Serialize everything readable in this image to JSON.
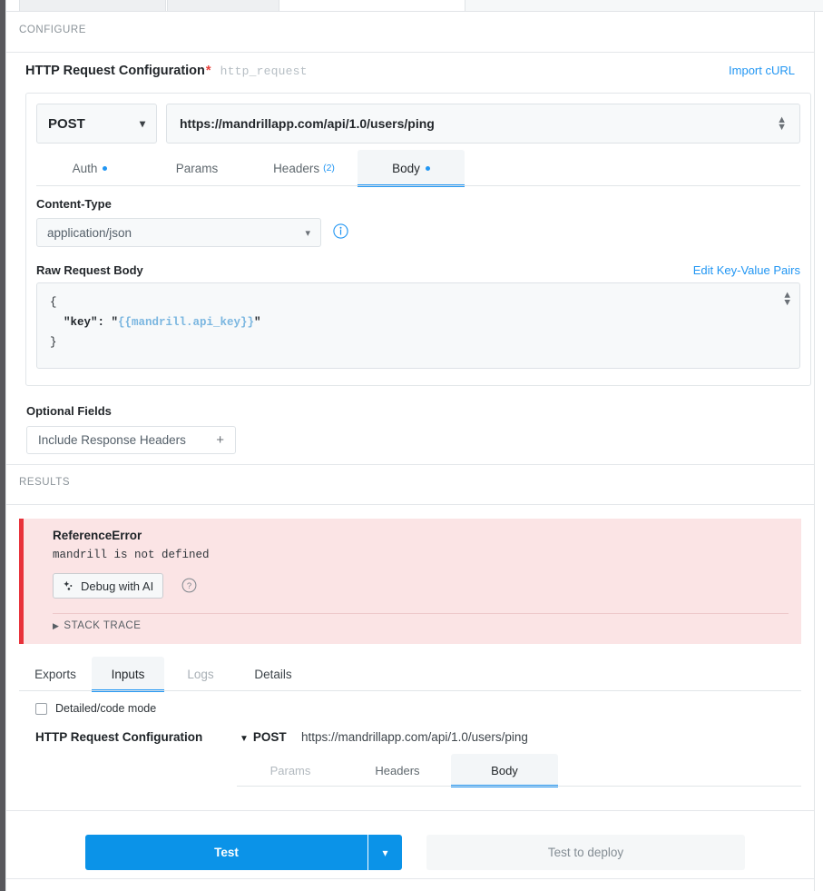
{
  "sections": {
    "configure_label": "CONFIGURE",
    "results_label": "RESULTS"
  },
  "config": {
    "title": "HTTP Request Configuration",
    "required_marker": "*",
    "slug": "http_request",
    "import_curl": "Import cURL",
    "method": "POST",
    "method_caret": "chevron-down-icon",
    "url": "https://mandrillapp.com/api/1.0/users/ping",
    "tabs": [
      {
        "label": "Auth",
        "dot": true,
        "count": "",
        "active": false
      },
      {
        "label": "Params",
        "dot": false,
        "count": "",
        "active": false
      },
      {
        "label": "Headers",
        "dot": false,
        "count": "(2)",
        "active": false
      },
      {
        "label": "Body",
        "dot": true,
        "count": "",
        "active": true
      }
    ],
    "content_type_label": "Content-Type",
    "content_type_value": "application/json",
    "info_icon": "info-circle-icon",
    "raw_body_label": "Raw Request Body",
    "edit_kv_link": "Edit Key-Value Pairs",
    "body_lines": {
      "open": "{",
      "key_part": "  \"key\": \"",
      "var_part": "{{mandrill.api_key}}",
      "close_quote": "\"",
      "close": "}"
    },
    "optional_fields_label": "Optional Fields",
    "optional_chip": "Include Response Headers",
    "optional_chip_plus": "+"
  },
  "results": {
    "error": {
      "type": "ReferenceError",
      "message": "mandrill is not defined",
      "debug_button": "Debug with AI",
      "debug_icon": "sparkles-icon",
      "help_icon": "help-circle-icon",
      "stack_trace": "STACK TRACE",
      "stack_caret": "triangle-right-icon"
    },
    "tabs": [
      {
        "label": "Exports",
        "active": false,
        "muted": false
      },
      {
        "label": "Inputs",
        "active": true,
        "muted": false
      },
      {
        "label": "Logs",
        "active": false,
        "muted": true
      },
      {
        "label": "Details",
        "active": false,
        "muted": false
      }
    ],
    "detailed_code_mode": "Detailed/code mode",
    "inputs": {
      "title": "HTTP Request Configuration",
      "method": "POST",
      "method_caret": "triangle-down-icon",
      "url": "https://mandrillapp.com/api/1.0/users/ping",
      "tabs": [
        {
          "label": "Params",
          "active": false,
          "muted": true
        },
        {
          "label": "Headers",
          "active": false,
          "muted": false
        },
        {
          "label": "Body",
          "active": true,
          "muted": false
        }
      ]
    }
  },
  "footer": {
    "test_label": "Test",
    "test_caret": "chevron-down-icon",
    "deploy_label": "Test to deploy"
  },
  "colors": {
    "accent_blue": "#2196f3",
    "button_blue": "#0b93e8",
    "error_red": "#e8323a",
    "error_bg": "#fbe4e5",
    "required_red": "#e8413c",
    "variable_blue": "#7ab6e0"
  }
}
